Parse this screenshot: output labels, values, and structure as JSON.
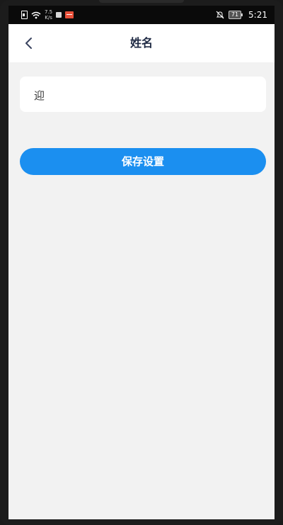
{
  "status_bar": {
    "network_speed_value": "7.5",
    "network_speed_unit": "K/s",
    "battery": "71",
    "time": "5:21"
  },
  "header": {
    "title": "姓名",
    "back_icon": "chevron-left-icon"
  },
  "form": {
    "name_value": "迎"
  },
  "actions": {
    "save_label": "保存设置"
  },
  "colors": {
    "primary": "#1b8ff0",
    "background": "#f2f2f2",
    "title_text": "#1f2a44"
  }
}
